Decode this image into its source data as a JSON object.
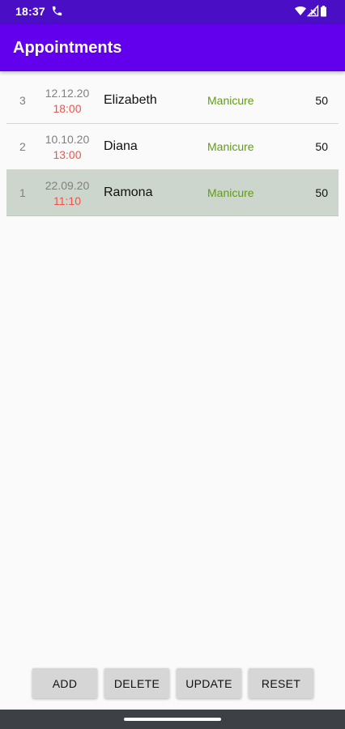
{
  "status_bar": {
    "time": "18:37",
    "icons": [
      "phone-icon",
      "wifi-icon",
      "cell-signal-icon",
      "battery-icon"
    ]
  },
  "app_bar": {
    "title": "Appointments"
  },
  "colors": {
    "status_bar": "#4a0fc4",
    "app_bar": "#6200ee",
    "time_text": "#f0534b",
    "service_text": "#5f9e0f",
    "selected_row": "#ccd6cc"
  },
  "appointments": [
    {
      "id": "3",
      "date": "12.12.20",
      "time": "18:00",
      "name": "Elizabeth",
      "service": "Manicure",
      "price": "50",
      "selected": false
    },
    {
      "id": "2",
      "date": "10.10.20",
      "time": "13:00",
      "name": "Diana",
      "service": "Manicure",
      "price": "50",
      "selected": false
    },
    {
      "id": "1",
      "date": "22.09.20",
      "time": "11:10",
      "name": "Ramona",
      "service": "Manicure",
      "price": "50",
      "selected": true
    }
  ],
  "buttons": {
    "add": "ADD",
    "delete": "DELETE",
    "update": "UPDATE",
    "reset": "RESET"
  }
}
